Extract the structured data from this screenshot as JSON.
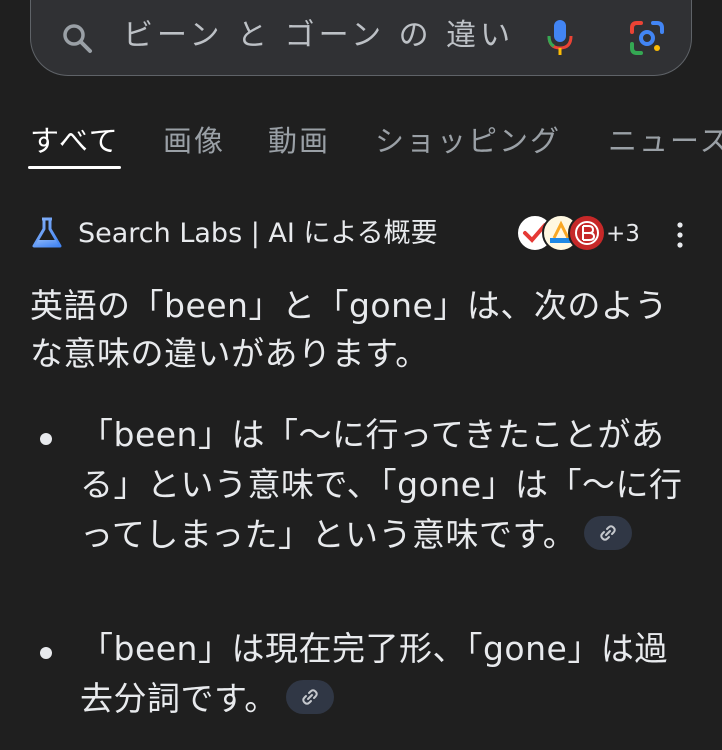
{
  "search": {
    "query": "ビーン と ゴーン の 違い"
  },
  "tabs": [
    {
      "label": "すべて",
      "active": true
    },
    {
      "label": "画像",
      "active": false
    },
    {
      "label": "動画",
      "active": false
    },
    {
      "label": "ショッピング",
      "active": false
    },
    {
      "label": "ニュース",
      "active": false
    }
  ],
  "ai_overview": {
    "title": "Search Labs | AI による概要",
    "more_sources": "+3",
    "intro": "英語の「been」と「gone」は、次のような意味の違いがあります。",
    "bullets": [
      {
        "text": "「been」は「～に行ってきたことがある」という意味で、「gone」は「～に行ってしまった」という意味です。"
      },
      {
        "text": "「been」は現在完了形、「gone」は過去分詞です。"
      }
    ]
  },
  "colors": {
    "background": "#1f1f1f",
    "search_bg": "#303134",
    "text": "#e8eaed",
    "muted": "#9aa0a6",
    "link_chip": "#303745"
  }
}
